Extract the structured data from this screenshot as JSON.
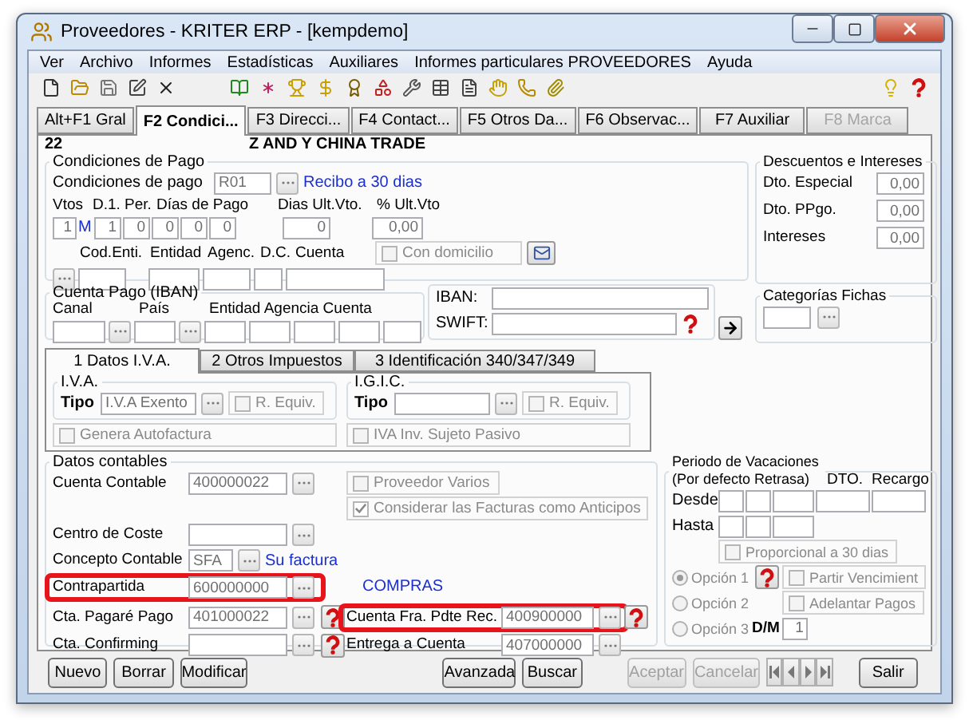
{
  "window": {
    "title": "Proveedores - KRITER ERP - [kempdemo]"
  },
  "menu": [
    "Ver",
    "Archivo",
    "Informes",
    "Estadísticas",
    "Auxiliares",
    "Informes particulares PROVEEDORES",
    "Ayuda"
  ],
  "tabs": [
    {
      "label": "Alt+F1 Gral",
      "selected": false,
      "disabled": false
    },
    {
      "label": "F2 Condici...",
      "selected": true,
      "disabled": false
    },
    {
      "label": "F3 Direcci...",
      "selected": false,
      "disabled": false
    },
    {
      "label": "F4 Contact...",
      "selected": false,
      "disabled": false
    },
    {
      "label": "F5 Otros Da...",
      "selected": false,
      "disabled": false
    },
    {
      "label": "F6 Observac...",
      "selected": false,
      "disabled": false
    },
    {
      "label": "F7 Auxiliar",
      "selected": false,
      "disabled": false
    },
    {
      "label": "F8 Marca",
      "selected": false,
      "disabled": true
    }
  ],
  "header": {
    "code": "22",
    "name": "Z AND Y CHINA TRADE"
  },
  "condiciones_pago": {
    "title": "Condiciones de Pago",
    "label": "Condiciones de pago",
    "code": "R01",
    "description": "Recibo a 30 dias",
    "column_labels": [
      "Vtos",
      "D.1.",
      "Per.",
      "Días de Pago",
      "Dias Ult.Vto.",
      "% Ult.Vto"
    ],
    "vtos": "1",
    "period": "M",
    "d1": "1",
    "per": "0",
    "dias_pago": [
      "0",
      "0",
      "0"
    ],
    "dias_ult_vto": "0",
    "pct_ult_vto": "0,00",
    "bank_labels": [
      "Cod.Enti.",
      "Entidad",
      "Agenc.",
      "D.C.",
      "Cuenta"
    ],
    "con_domicilio": {
      "label": "Con domicilio",
      "checked": false
    }
  },
  "cuenta_pago": {
    "title": "Cuenta Pago (IBAN)",
    "labels": [
      "Canal",
      "País",
      "Entidad Agencia Cuenta"
    ]
  },
  "iban": {
    "iban_label": "IBAN:",
    "swift_label": "SWIFT:"
  },
  "descuentos": {
    "title": "Descuentos e Intereses",
    "rows": [
      {
        "label": "Dto. Especial",
        "value": "0,00"
      },
      {
        "label": "Dto. PPgo.",
        "value": "0,00"
      },
      {
        "label": "Intereses",
        "value": "0,00"
      }
    ]
  },
  "categorias": {
    "title": "Categorías Fichas"
  },
  "sub_tabs": [
    {
      "label": "1 Datos I.V.A.",
      "selected": true
    },
    {
      "label": "2 Otros Impuestos",
      "selected": false
    },
    {
      "label": "3 Identificación 340/347/349",
      "selected": false
    }
  ],
  "tax_groups": [
    {
      "title": "I.V.A.",
      "tipo_label": "Tipo",
      "tipo": "I.V.A Exento",
      "equiv": {
        "label": "R. Equiv.",
        "checked": false
      },
      "extra": {
        "label": "Genera Autofactura",
        "checked": false
      }
    },
    {
      "title": "I.G.I.C.",
      "tipo_label": "Tipo",
      "equiv": {
        "label": "R. Equiv.",
        "checked": false
      },
      "extra": {
        "label": "IVA Inv. Sujeto Pasivo",
        "checked": false
      }
    }
  ],
  "datos_contables": {
    "title": "Datos contables",
    "rows": [
      {
        "label": "Cuenta Contable",
        "value": "400000022",
        "highlighted": false,
        "help": false
      },
      {
        "label": "Centro de Coste",
        "highlighted": false,
        "help": false
      },
      {
        "label": "Concepto Contable",
        "value": "SFA",
        "link": "Su factura",
        "highlighted": false,
        "help": false
      },
      {
        "label": "Contrapartida",
        "value": "600000000",
        "highlighted": true,
        "help": false
      },
      {
        "label": "Cta. Pagaré Pago",
        "value": "401000022",
        "highlighted": false,
        "help": true
      },
      {
        "label": "Cta. Confirming",
        "highlighted": false,
        "help": true
      }
    ],
    "checks": [
      {
        "label": "Proveedor Varios",
        "checked": false
      },
      {
        "label": "Considerar las Facturas como Anticipos",
        "checked": true
      }
    ],
    "compras_title": "COMPRAS",
    "compras": [
      {
        "label": "Cuenta Fra. Pdte Rec.",
        "value": "400900000",
        "highlighted": true,
        "help": true
      },
      {
        "label": "Entrega a Cuenta",
        "value": "407000000",
        "highlighted": false,
        "help": false
      }
    ]
  },
  "vacaciones": {
    "title": "Periodo de Vacaciones (Por defecto Retrasa)",
    "column_labels": [
      "DTO.",
      "Recargo"
    ],
    "desde": "Desde",
    "hasta": "Hasta",
    "proporcional": {
      "label": "Proporcional a 30 dias",
      "checked": false
    },
    "options": [
      {
        "label": "Opción 1",
        "selected": true
      },
      {
        "label": "Opción 2",
        "selected": false
      },
      {
        "label": "Opción 3",
        "selected": false
      }
    ],
    "dm_label": "D/M",
    "dm_value": "1",
    "checks": [
      {
        "label": "Partir Vencimient",
        "checked": false
      },
      {
        "label": "Adelantar Pagos",
        "checked": false
      }
    ]
  },
  "button_groups": [
    [
      {
        "label": "Nuevo",
        "disabled": false
      },
      {
        "label": "Borrar",
        "disabled": false
      },
      {
        "label": "Modificar",
        "disabled": false
      }
    ],
    [
      {
        "label": "Avanzada",
        "disabled": false
      },
      {
        "label": "Buscar",
        "disabled": false
      }
    ],
    [
      {
        "label": "Aceptar",
        "disabled": true
      },
      {
        "label": "Cancelar",
        "disabled": true
      }
    ]
  ],
  "exit_button": {
    "label": "Salir",
    "disabled": false
  }
}
